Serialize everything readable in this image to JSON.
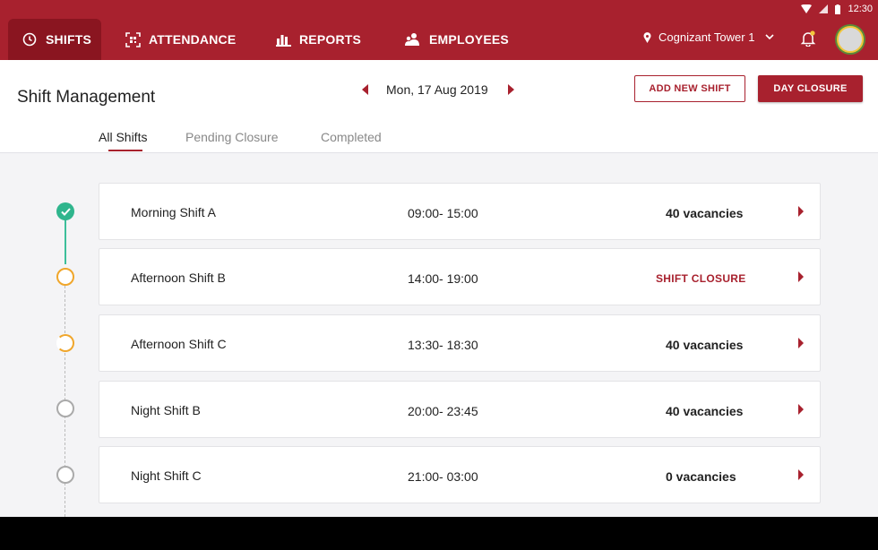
{
  "status_bar": {
    "time": "12:30"
  },
  "nav": {
    "tabs": [
      {
        "label": "SHIFTS",
        "icon": "clock-icon",
        "active": true
      },
      {
        "label": "ATTENDANCE",
        "icon": "qr-scan-icon",
        "active": false
      },
      {
        "label": "REPORTS",
        "icon": "bar-chart-icon",
        "active": false
      },
      {
        "label": "EMPLOYEES",
        "icon": "employees-icon",
        "active": false
      }
    ],
    "location": "Cognizant Tower 1"
  },
  "header": {
    "title": "Shift Management",
    "date": "Mon, 17 Aug 2019",
    "add_shift_label": "ADD NEW SHIFT",
    "day_closure_label": "DAY CLOSURE"
  },
  "tabs": {
    "all": "All Shifts",
    "pending": "Pending Closure",
    "completed": "Completed"
  },
  "shifts": [
    {
      "name": "Morning Shift A",
      "time": "09:00- 15:00",
      "status": "40 vacancies",
      "state": "done"
    },
    {
      "name": "Afternoon Shift B",
      "time": "14:00- 19:00",
      "status": "SHIFT CLOSURE",
      "state": "pending"
    },
    {
      "name": "Afternoon Shift C",
      "time": "13:30- 18:30",
      "status": "40 vacancies",
      "state": "partial"
    },
    {
      "name": "Night Shift B",
      "time": "20:00- 23:45",
      "status": "40 vacancies",
      "state": "idle"
    },
    {
      "name": "Night Shift C",
      "time": "21:00- 03:00",
      "status": "0 vacancies",
      "state": "idle"
    }
  ],
  "colors": {
    "brand": "#a8212e",
    "done": "#2fb58d",
    "pending": "#f0a62b"
  }
}
